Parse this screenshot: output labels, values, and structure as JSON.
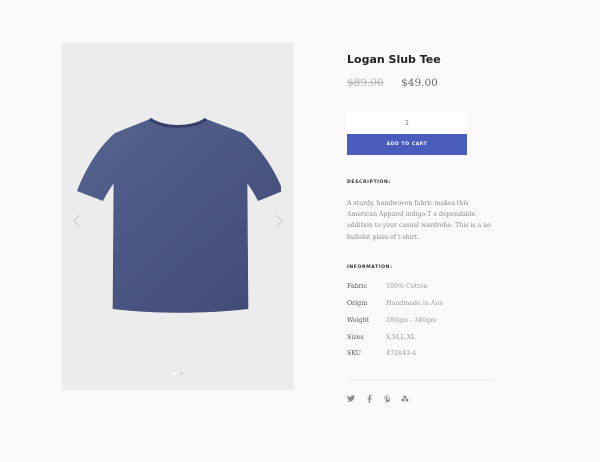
{
  "product": {
    "title": "Logan Slub Tee",
    "price_original": "$89.00",
    "price_current": "$49.00",
    "quantity": "1",
    "add_to_cart_label": "ADD TO CART",
    "colors": {
      "shirt": "#4b5785",
      "button": "#4a5dbd"
    }
  },
  "gallery": {
    "icons": {
      "prev": "chevron-left-icon",
      "next": "chevron-right-icon"
    },
    "slides": 2,
    "active_slide": 1
  },
  "description": {
    "label": "DESCRIPTION:",
    "text": "A sturdy, handwoven fabric makes this American Apparel indigo-T a dependable addition to your casual wardrobe. This is a no bullshit plain of t-shirt."
  },
  "information": {
    "label": "INFORMATION:",
    "rows": [
      {
        "key": "Fabric",
        "value": "100% Cotton"
      },
      {
        "key": "Origin",
        "value": "Handmade in Aus"
      },
      {
        "key": "Weight",
        "value": "280gm - 340gm"
      },
      {
        "key": "Sizes",
        "value": "S,M,L,XL"
      },
      {
        "key": "SKU",
        "value": "472843-4"
      }
    ]
  },
  "social": [
    {
      "name": "twitter-icon",
      "glyph": "🐦"
    },
    {
      "name": "facebook-icon",
      "glyph": "f"
    },
    {
      "name": "pinterest-icon",
      "glyph": "p"
    },
    {
      "name": "dribbble-icon",
      "glyph": "✿"
    }
  ]
}
